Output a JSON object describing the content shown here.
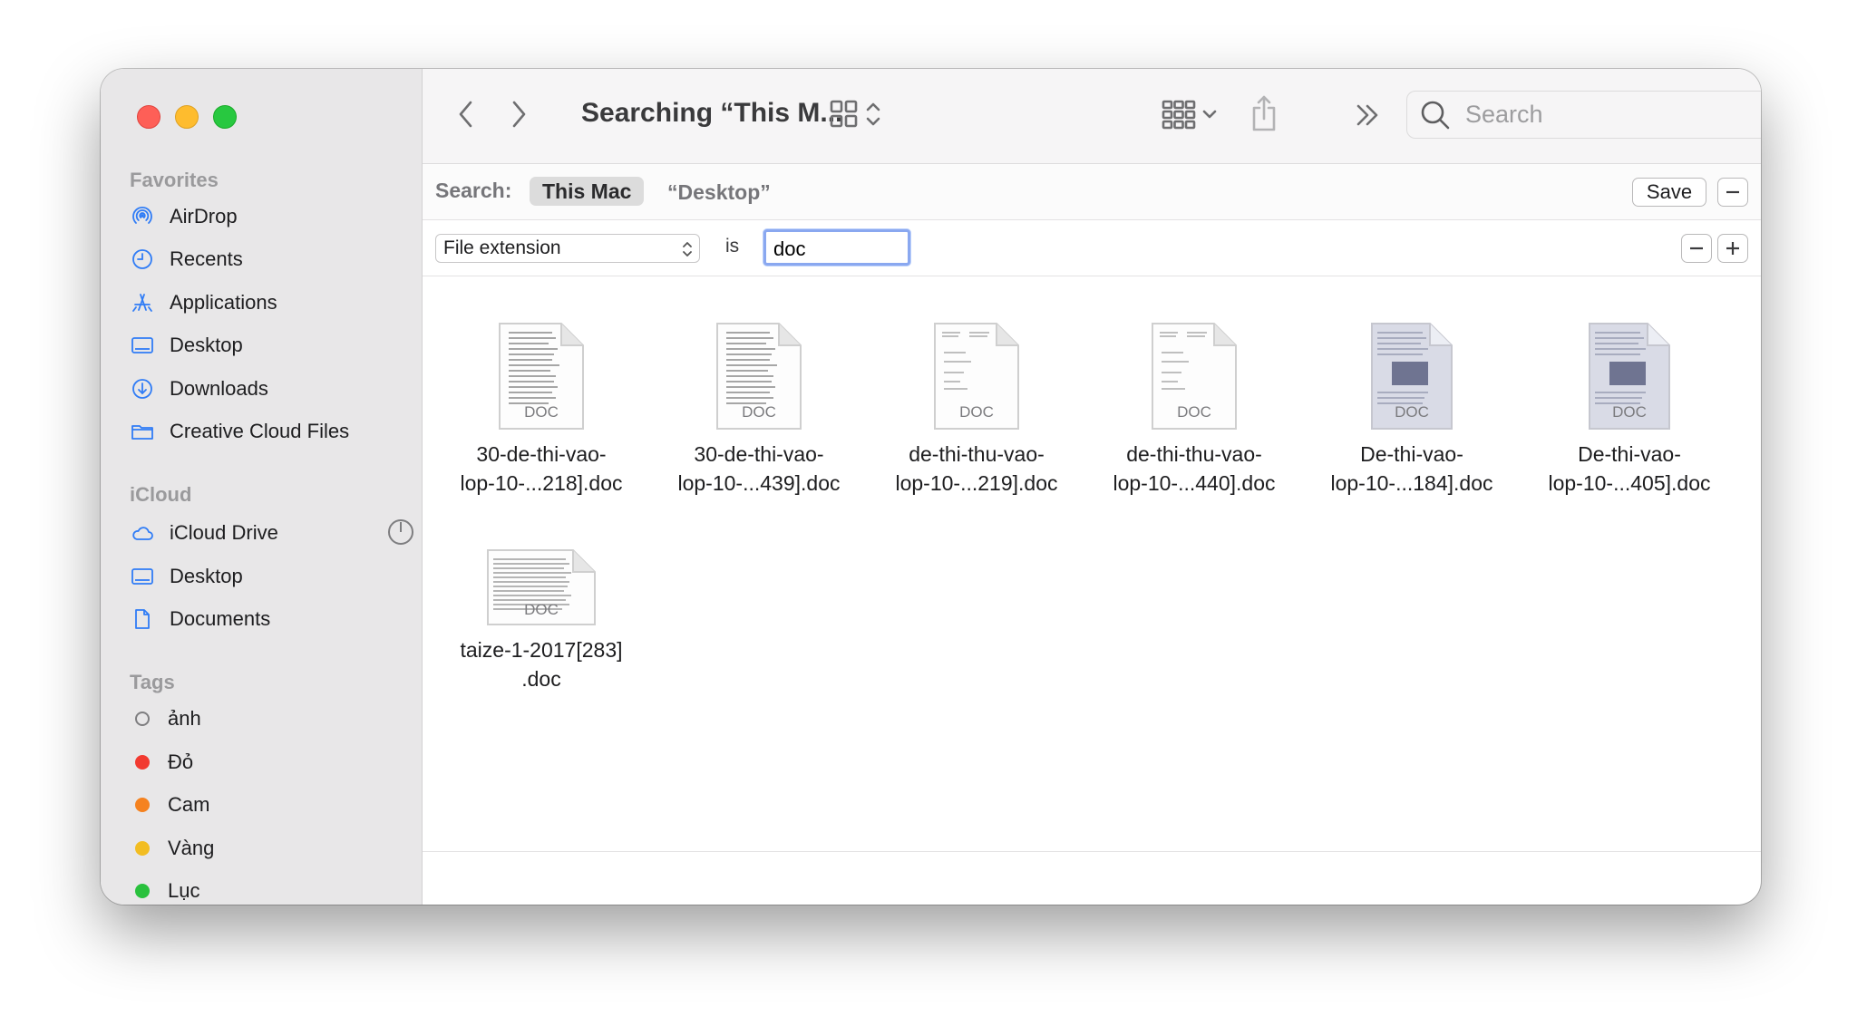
{
  "sidebar": {
    "favorites_header": "Favorites",
    "favorites": [
      {
        "label": "AirDrop",
        "icon": "airdrop-icon"
      },
      {
        "label": "Recents",
        "icon": "clock-icon"
      },
      {
        "label": "Applications",
        "icon": "applications-icon"
      },
      {
        "label": "Desktop",
        "icon": "desktop-icon"
      },
      {
        "label": "Downloads",
        "icon": "download-icon"
      },
      {
        "label": "Creative Cloud Files",
        "icon": "folder-icon"
      }
    ],
    "icloud_header": "iCloud",
    "icloud": [
      {
        "label": "iCloud Drive",
        "icon": "cloud-icon"
      },
      {
        "label": "Desktop",
        "icon": "desktop-icon"
      },
      {
        "label": "Documents",
        "icon": "document-icon"
      }
    ],
    "tags_header": "Tags",
    "tags": [
      {
        "label": "ảnh",
        "color": "none"
      },
      {
        "label": "Đỏ",
        "color": "#f23a30"
      },
      {
        "label": "Cam",
        "color": "#f5821f"
      },
      {
        "label": "Vàng",
        "color": "#f2bd22"
      },
      {
        "label": "Lục",
        "color": "#29c13d"
      }
    ]
  },
  "toolbar": {
    "title": "Searching “This M...",
    "search_placeholder": "Search"
  },
  "scope": {
    "label": "Search:",
    "active": "This Mac",
    "other": "“Desktop”",
    "save_label": "Save"
  },
  "criteria": {
    "attribute": "File extension",
    "operator": "is",
    "value": "doc"
  },
  "files": [
    {
      "line1": "30-de-thi-vao-",
      "line2": "lop-10-...218].doc",
      "badge": "DOC"
    },
    {
      "line1": "30-de-thi-vao-",
      "line2": "lop-10-...439].doc",
      "badge": "DOC"
    },
    {
      "line1": "de-thi-thu-vao-",
      "line2": "lop-10-...219].doc",
      "badge": "DOC"
    },
    {
      "line1": "de-thi-thu-vao-",
      "line2": "lop-10-...440].doc",
      "badge": "DOC"
    },
    {
      "line1": "De-thi-vao-",
      "line2": "lop-10-...184].doc",
      "badge": "DOC"
    },
    {
      "line1": "De-thi-vao-",
      "line2": "lop-10-...405].doc",
      "badge": "DOC"
    },
    {
      "line1": "taize-1-2017[283]",
      "line2": ".doc",
      "badge": "DOC"
    }
  ],
  "colors": {
    "sidebar_bg": "#e8e7e8",
    "accent_icon": "#2f7cf6",
    "focus_ring": "#8aa8f0"
  }
}
